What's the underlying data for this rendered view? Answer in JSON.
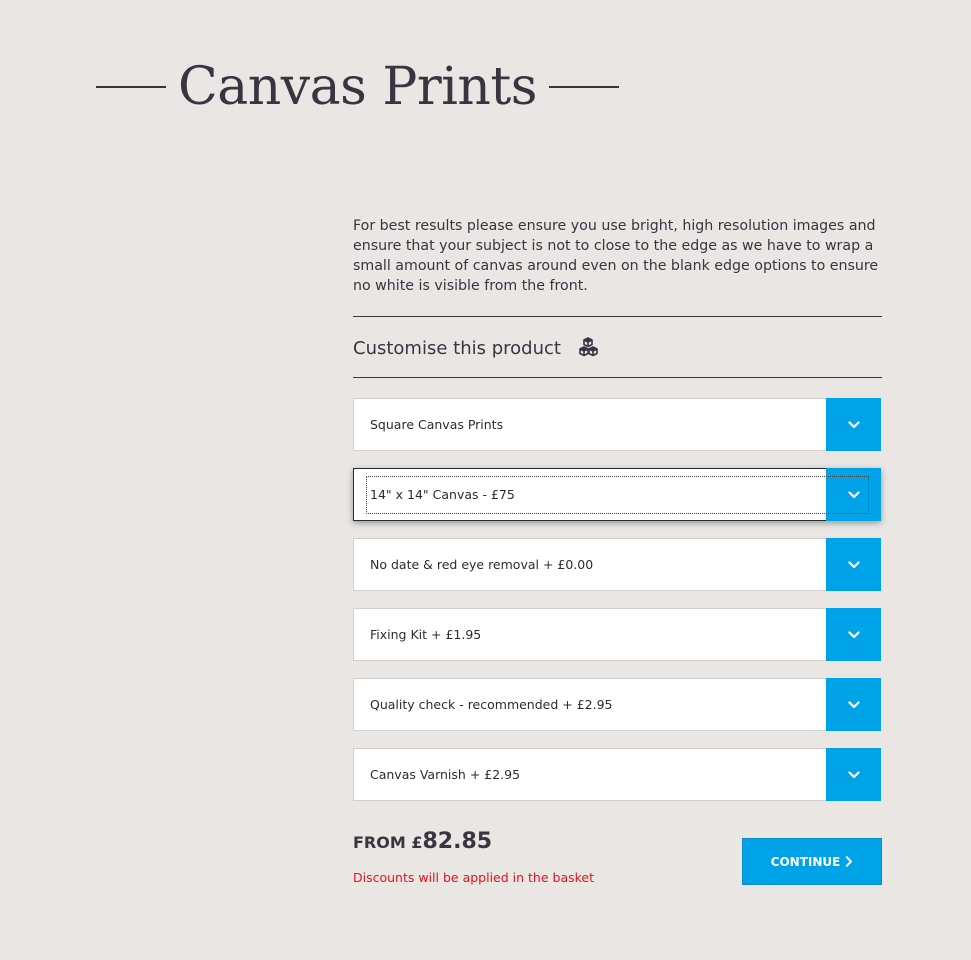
{
  "page": {
    "title": "Canvas Prints",
    "intro": "For best results please ensure you use bright, high resolution images and ensure that your subject is not to close to the edge as we have to wrap a small amount of canvas around even on the blank edge options to ensure no white is visible from the front."
  },
  "customise": {
    "title": "Customise this product",
    "icon": "cubes-icon"
  },
  "options": [
    {
      "label": "Square Canvas Prints"
    },
    {
      "label": "14\" x 14\" Canvas - £75"
    },
    {
      "label": "No date & red eye removal + £0.00"
    },
    {
      "label": "Fixing Kit + £1.95"
    },
    {
      "label": "Quality check - recommended + £2.95"
    },
    {
      "label": "Canvas Varnish + £2.95"
    }
  ],
  "price": {
    "prefix": "FROM £",
    "value": "82.85",
    "note": "Discounts will be applied in the basket"
  },
  "actions": {
    "continue_label": "CONTINUE",
    "continue_icon": "chevron-right-icon"
  },
  "colors": {
    "background": "#e9e6e3",
    "accent": "#00a2e8",
    "text": "#3a3340",
    "note": "#e0141e"
  }
}
